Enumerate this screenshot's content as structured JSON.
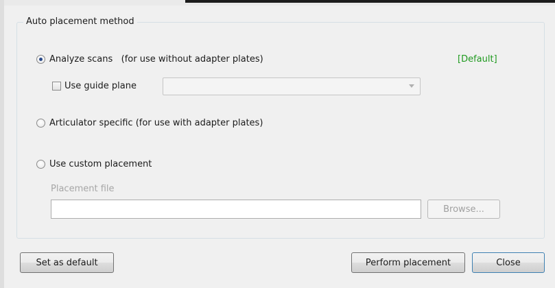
{
  "dialog": {
    "group_title": "Auto placement method",
    "options": {
      "analyze_scans": {
        "label": "Analyze scans   (for use without adapter plates)",
        "selected": true
      },
      "articulator_specific": {
        "label": "Articulator specific (for use with adapter plates)",
        "selected": false
      },
      "custom_placement": {
        "label": "Use custom placement",
        "selected": false
      }
    },
    "default_tag": "[Default]",
    "guide_plane": {
      "label": "Use guide plane",
      "checked": false,
      "combo_value": ""
    },
    "placement_file": {
      "label": "Placement file",
      "value": "",
      "browse_label": "Browse..."
    },
    "buttons": {
      "set_default": "Set as default",
      "perform_placement": "Perform placement",
      "close": "Close"
    }
  }
}
